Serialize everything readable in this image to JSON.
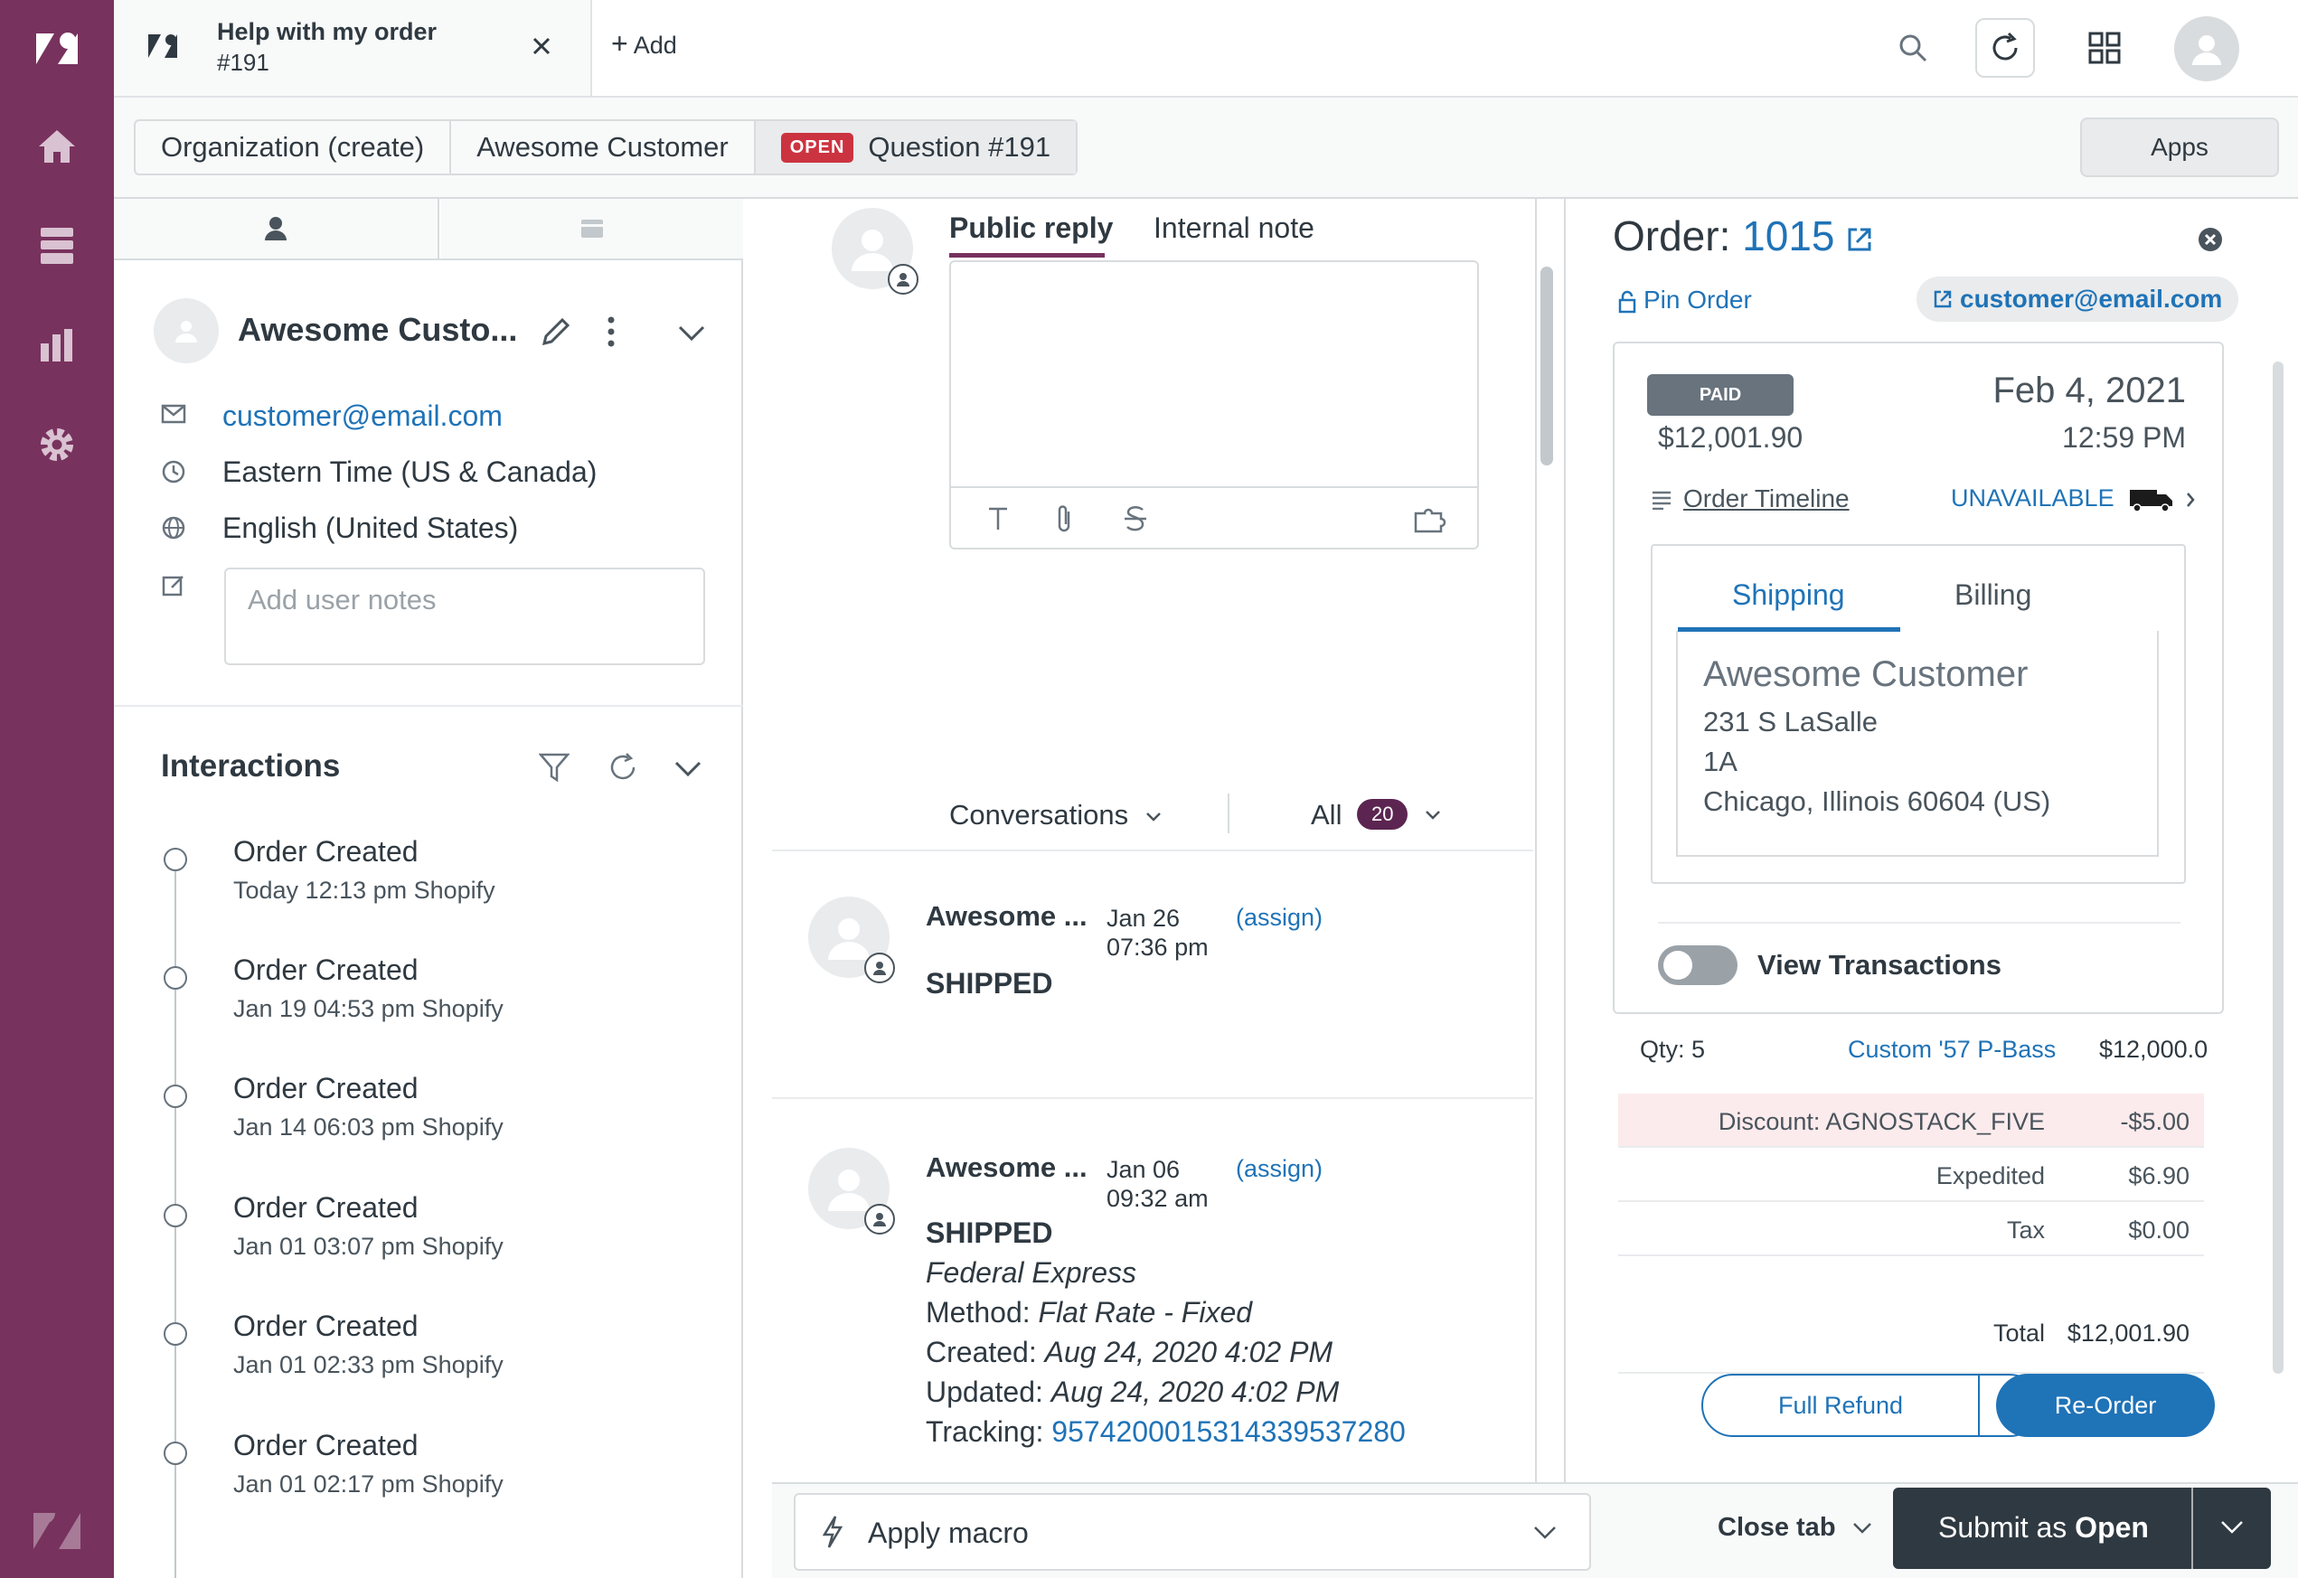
{
  "nav": {
    "items": [
      "home",
      "views",
      "reporting",
      "admin"
    ]
  },
  "topbar": {
    "tab_title": "Help with my order",
    "tab_subtitle": "#191",
    "add_label": "Add"
  },
  "breadcrumb": {
    "items": [
      "Organization (create)",
      "Awesome Customer"
    ],
    "status_badge": "OPEN",
    "ticket_label": "Question #191"
  },
  "apps_label": "Apps",
  "user": {
    "name": "Awesome Custo...",
    "email": "customer@email.com",
    "timezone": "Eastern Time (US & Canada)",
    "language": "English (United States)",
    "notes_placeholder": "Add user notes"
  },
  "interactions": {
    "title": "Interactions",
    "items": [
      {
        "title": "Order Created",
        "sub": "Today 12:13 pm Shopify"
      },
      {
        "title": "Order Created",
        "sub": "Jan 19 04:53 pm Shopify"
      },
      {
        "title": "Order Created",
        "sub": "Jan 14 06:03 pm Shopify"
      },
      {
        "title": "Order Created",
        "sub": "Jan 01 03:07 pm Shopify"
      },
      {
        "title": "Order Created",
        "sub": "Jan 01 02:33 pm Shopify"
      },
      {
        "title": "Order Created",
        "sub": "Jan 01 02:17 pm Shopify"
      }
    ]
  },
  "composer": {
    "public_reply": "Public reply",
    "internal_note": "Internal note"
  },
  "conversations": {
    "label": "Conversations",
    "filter_label": "All",
    "count": "20"
  },
  "messages": [
    {
      "author": "Awesome ...",
      "date": "Jan 26",
      "time": "07:36 pm",
      "assign": "(assign)",
      "status": "SHIPPED"
    },
    {
      "author": "Awesome ...",
      "date": "Jan 06",
      "time": "09:32 am",
      "assign": "(assign)",
      "status": "SHIPPED",
      "carrier": "Federal Express",
      "method_label": "Method:",
      "method": "Flat Rate - Fixed",
      "created_label": "Created:",
      "created": "Aug 24, 2020 4:02 PM",
      "updated_label": "Updated:",
      "updated": "Aug 24, 2020 4:02 PM",
      "tracking_label": "Tracking:",
      "tracking": "9574200015314339537280"
    }
  ],
  "bottombar": {
    "macro_label": "Apply macro",
    "close_tab": "Close tab",
    "submit_prefix": "Submit as",
    "submit_status": "Open"
  },
  "order": {
    "title_prefix": "Order:",
    "number": "1015",
    "pin_label": "Pin Order",
    "email": "customer@email.com",
    "paid_badge": "PAID",
    "amount": "$12,001.90",
    "date": "Feb 4, 2021",
    "time": "12:59 PM",
    "timeline_label": "Order Timeline",
    "shipment_status": "UNAVAILABLE",
    "tabs": {
      "shipping": "Shipping",
      "billing": "Billing"
    },
    "address": {
      "name": "Awesome Customer",
      "line1": "231 S LaSalle",
      "line2": "1A",
      "line3": "Chicago, Illinois 60604 (US)"
    },
    "view_transactions": "View Transactions",
    "item": {
      "qty": "Qty: 5",
      "product": "Custom '57 P-Bass",
      "price": "$12,000.0"
    },
    "lines": [
      {
        "label": "Discount: AGNOSTACK_FIVE",
        "value": "-$5.00",
        "highlight": true
      },
      {
        "label": "Expedited",
        "value": "$6.90"
      },
      {
        "label": "Tax",
        "value": "$0.00"
      }
    ],
    "total_label": "Total",
    "total_value": "$12,001.90",
    "full_refund": "Full Refund",
    "reorder": "Re-Order"
  },
  "colors": {
    "nav_bg": "#78325e",
    "accent_blue": "#1f73b7",
    "open_badge": "#cc3340",
    "count_badge": "#5c2551",
    "submit_bg": "#2f3941",
    "discount_bg": "#fcebec"
  }
}
